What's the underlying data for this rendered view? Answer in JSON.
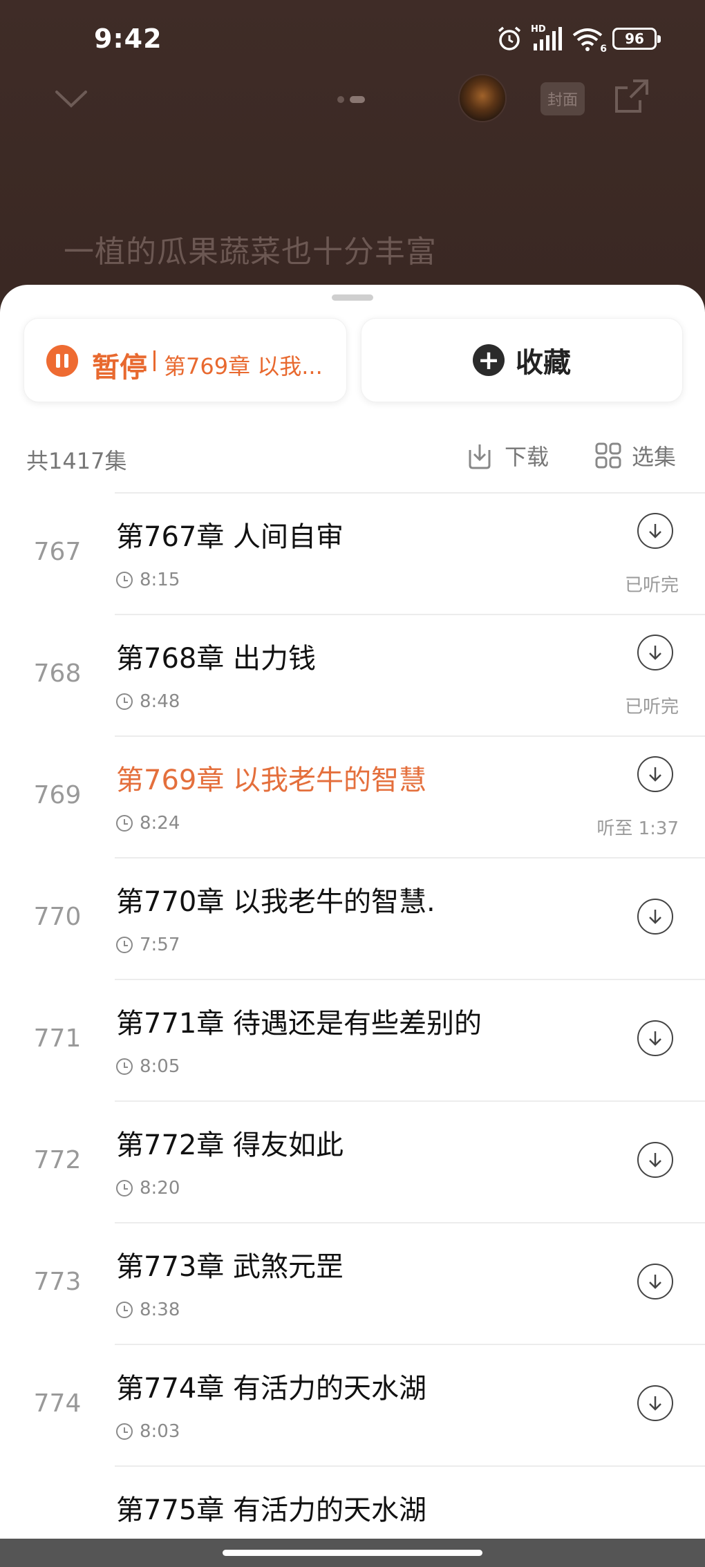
{
  "status_bar": {
    "time": "9:42",
    "battery": "96",
    "network": "HD",
    "wifi_badge": "6"
  },
  "player": {
    "cover_label": "封面",
    "lyric_line": "一植的瓜果蔬菜也十分丰富"
  },
  "actions": {
    "pause_label": "暂停",
    "now_playing_short": "第769章 以我...",
    "favorite_label": "收藏"
  },
  "list_header": {
    "count": "共1417集",
    "download_label": "下载",
    "select_label": "选集"
  },
  "episodes": [
    {
      "num": "767",
      "title": "第767章 人间自审",
      "duration": "8:15",
      "status": "已听完",
      "playing": false
    },
    {
      "num": "768",
      "title": "第768章 出力钱",
      "duration": "8:48",
      "status": "已听完",
      "playing": false
    },
    {
      "num": "769",
      "title": "第769章 以我老牛的智慧",
      "duration": "8:24",
      "status": "听至 1:37",
      "playing": true
    },
    {
      "num": "770",
      "title": "第770章 以我老牛的智慧.",
      "duration": "7:57",
      "status": "",
      "playing": false
    },
    {
      "num": "771",
      "title": "第771章 待遇还是有些差别的",
      "duration": "8:05",
      "status": "",
      "playing": false
    },
    {
      "num": "772",
      "title": "第772章 得友如此",
      "duration": "8:20",
      "status": "",
      "playing": false
    },
    {
      "num": "773",
      "title": "第773章 武煞元罡",
      "duration": "8:38",
      "status": "",
      "playing": false
    },
    {
      "num": "774",
      "title": "第774章 有活力的天水湖",
      "duration": "8:03",
      "status": "",
      "playing": false
    },
    {
      "num": "",
      "title": "第775章 有活力的天水湖",
      "duration": "",
      "status": "",
      "playing": false
    }
  ],
  "colors": {
    "accent": "#e8692f",
    "sheet": "#ffffff",
    "backdrop": "#3b2a25"
  }
}
